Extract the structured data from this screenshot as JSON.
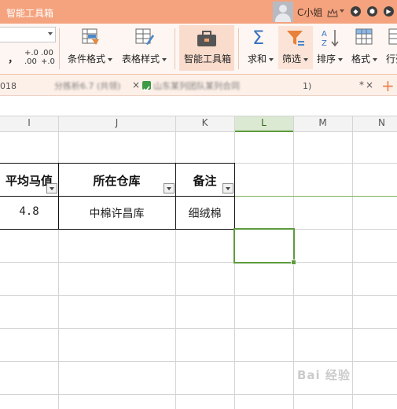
{
  "window": {
    "title": "智能工具箱",
    "user_name": "C小姐"
  },
  "ribbon": {
    "buttons": [
      {
        "label": "条件格式",
        "icon": "conditional-format-icon",
        "dropdown": true
      },
      {
        "label": "表格样式",
        "icon": "table-style-icon",
        "dropdown": true
      },
      {
        "label": "智能工具箱",
        "icon": "toolbox-icon",
        "dropdown": false,
        "active": true
      },
      {
        "label": "求和",
        "icon": "sigma-icon",
        "dropdown": true
      },
      {
        "label": "筛选",
        "icon": "filter-icon",
        "dropdown": true
      },
      {
        "label": "排序",
        "icon": "sort-icon",
        "dropdown": true
      },
      {
        "label": "格式",
        "icon": "format-icon",
        "dropdown": true
      },
      {
        "label": "行列"
      }
    ],
    "number_format_glyphs": [
      "，",
      "+.0 .00",
      ".00 +.0"
    ]
  },
  "doc_tabs": {
    "tab1": "018",
    "tab1_suffix": "分拣析6.7 (共领)",
    "tab2": "山东某列团队某列合同",
    "tab2_suffix": "1)",
    "modified": "*",
    "close": "×",
    "new_tab": "+"
  },
  "sheet": {
    "columns": [
      "I",
      "J",
      "K",
      "L",
      "M",
      "N"
    ],
    "headers": [
      "平均马值",
      "所在仓库",
      "备注"
    ],
    "row": [
      "4.8",
      "中棉许昌库",
      "细绒棉"
    ]
  },
  "colors": {
    "titlebar": "#f4a37e",
    "selected_column": "#dbe9d3",
    "selection_border": "#5d9b3e"
  },
  "watermark": "Bai 经验"
}
